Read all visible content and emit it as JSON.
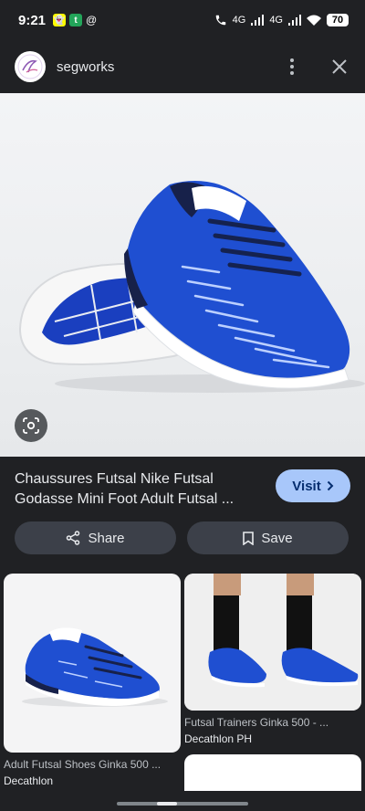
{
  "status": {
    "time": "9:21",
    "badges": [
      "snapchat-icon",
      "t-icon",
      "threads-icon"
    ],
    "battery": "70",
    "network": "4G"
  },
  "header": {
    "site_name": "segworks"
  },
  "result": {
    "title": "Chaussures Futsal Nike Futsal Godasse Mini Foot Adult Futsal ...",
    "visit_label": "Visit",
    "share_label": "Share",
    "save_label": "Save"
  },
  "related": [
    {
      "title": "Adult Futsal Shoes Ginka 500 ...",
      "source": "Decathlon"
    },
    {
      "title": "Futsal Trainers Ginka 500 - ...",
      "source": "Decathlon PH"
    }
  ],
  "colors": {
    "background": "#202124",
    "accent": "#a8c7fa",
    "shoe_blue": "#1f4fd1"
  }
}
